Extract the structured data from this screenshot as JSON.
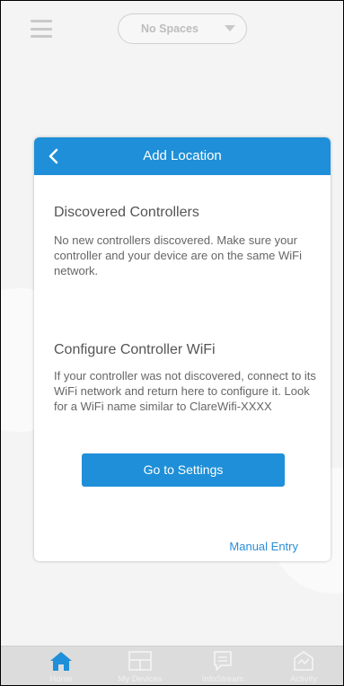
{
  "topbar": {
    "spaces_selected": "No Spaces"
  },
  "card": {
    "title": "Add Location",
    "discovered": {
      "heading": "Discovered Controllers",
      "body": "No new controllers discovered. Make sure your controller and your device are on the same WiFi network."
    },
    "configure": {
      "heading": "Configure Controller WiFi",
      "body": "If your controller was not discovered, connect to its WiFi network and return here to configure it. Look for a WiFi name similar to ClareWifi-XXXX"
    },
    "settings_button": "Go to Settings",
    "manual_entry": "Manual Entry"
  },
  "tabbar": {
    "items": [
      {
        "label": "Home",
        "icon": "home-icon"
      },
      {
        "label": "My Devices",
        "icon": "devices-icon"
      },
      {
        "label": "InfoStream",
        "icon": "infostream-icon"
      },
      {
        "label": "Activity",
        "icon": "activity-icon"
      }
    ]
  },
  "colors": {
    "accent": "#1e8fd8",
    "tab_active": "#1e8fd8",
    "tabbar_bg": "#dcdcdc"
  }
}
